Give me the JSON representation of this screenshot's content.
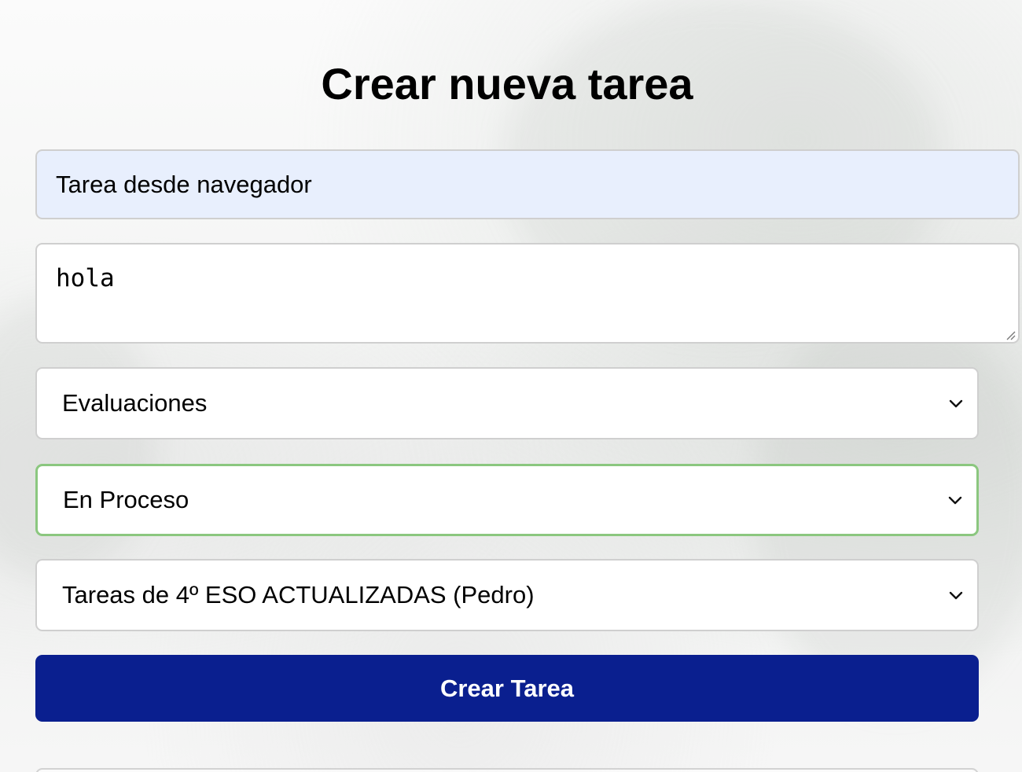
{
  "form": {
    "heading": "Crear nueva tarea",
    "title_value": "Tarea desde navegador",
    "description_value": "hola",
    "category_selected": "Evaluaciones",
    "status_selected": "En Proceso",
    "list_selected": "Tareas de 4º ESO ACTUALIZADAS (Pedro)",
    "submit_label": "Crear Tarea"
  },
  "colors": {
    "accent_button": "#0a1f8f",
    "focused_border": "#8bc77f",
    "autofill_background": "#e8effd"
  },
  "icons": {
    "select_arrow": "chevron-down-icon",
    "textarea_resize": "resize-grip-icon"
  }
}
